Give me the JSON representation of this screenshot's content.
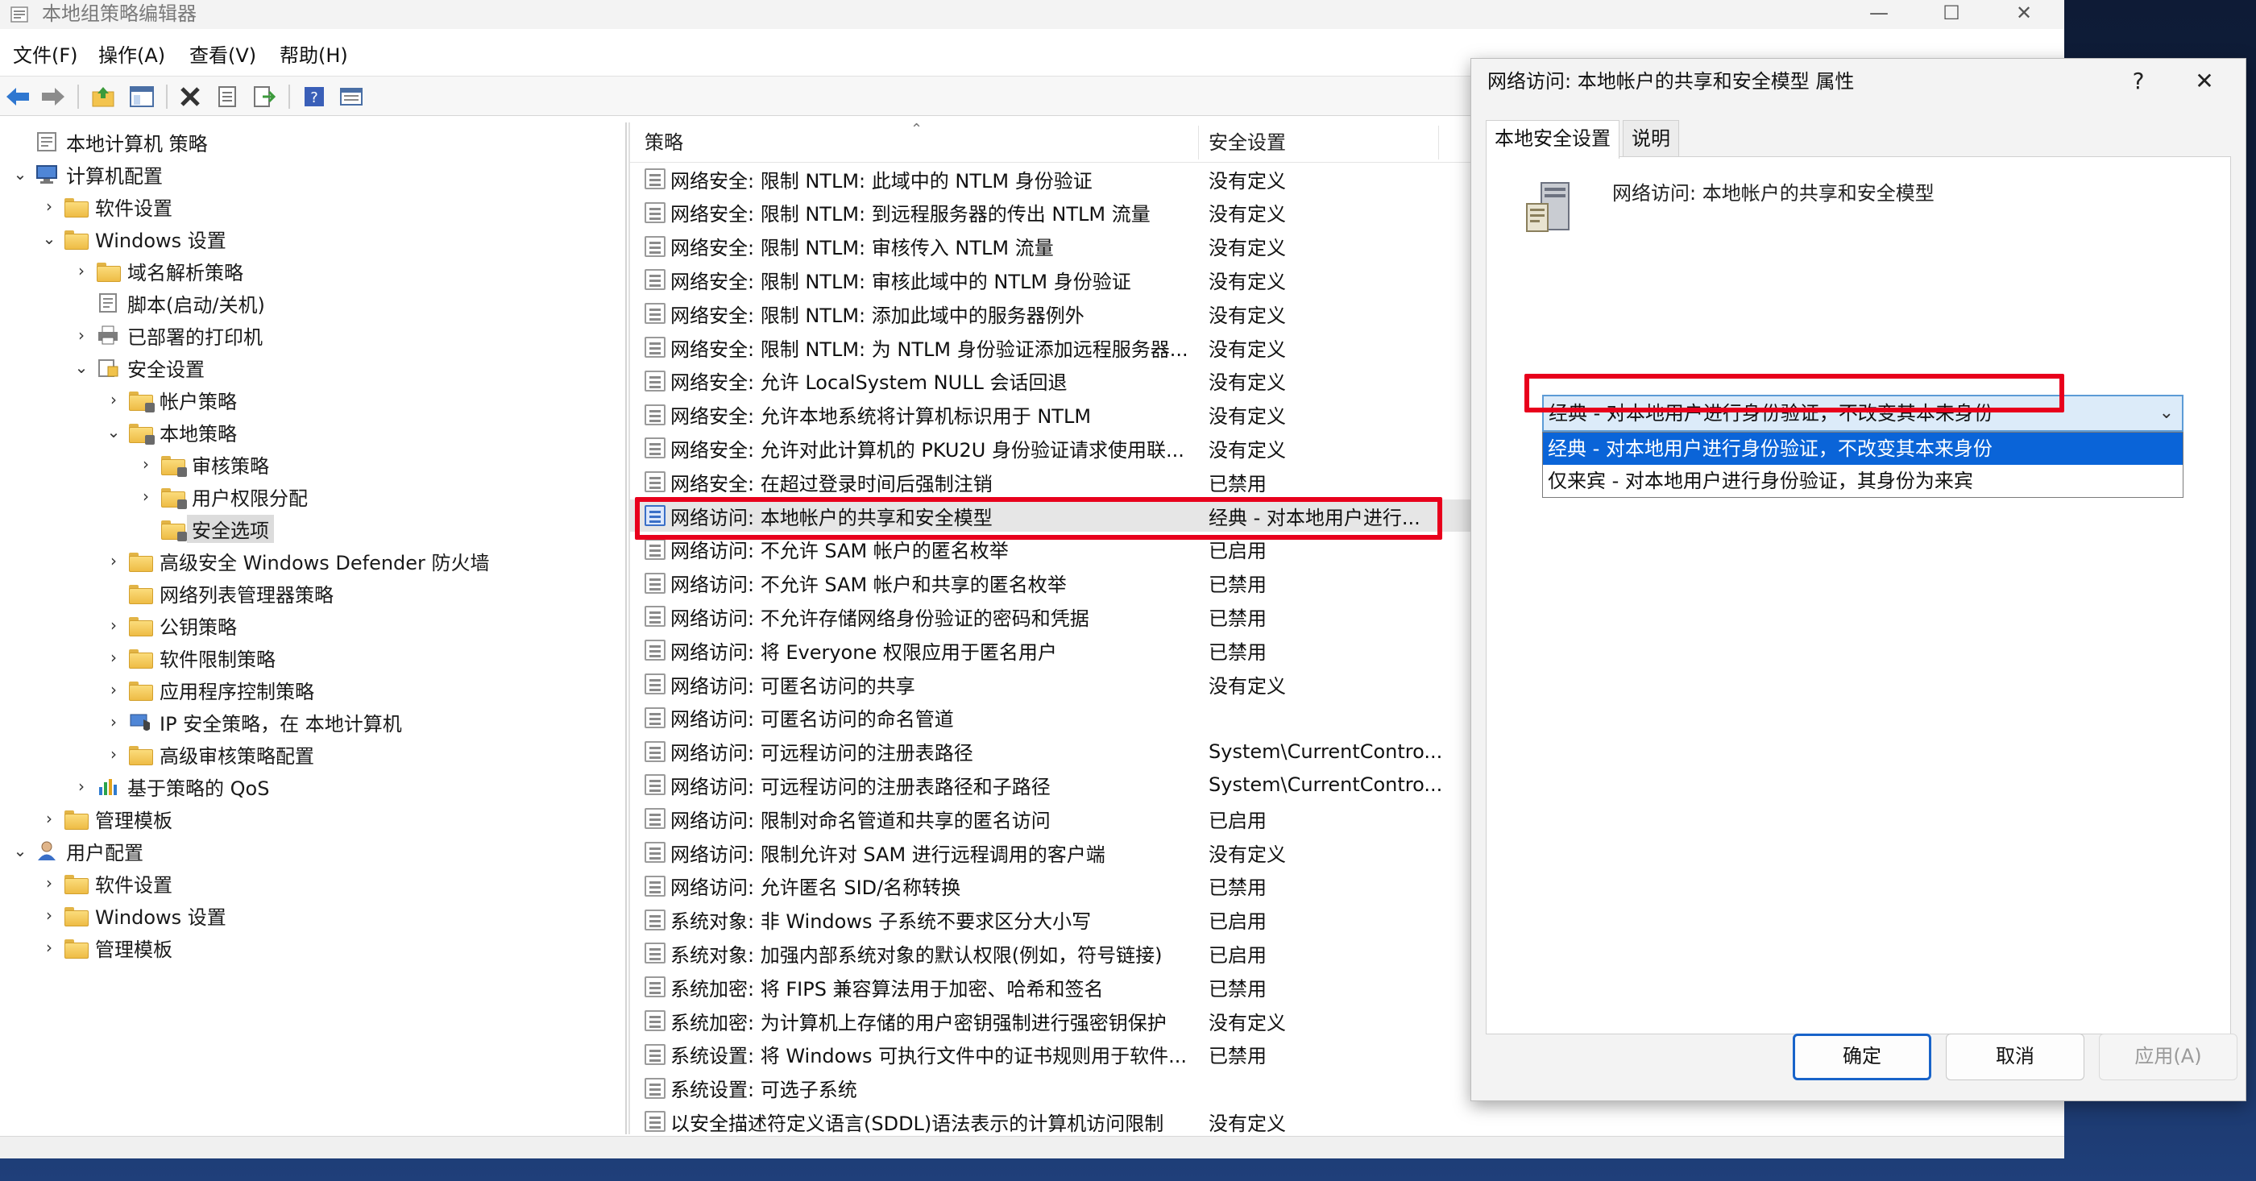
{
  "window": {
    "title": "本地组策略编辑器",
    "controls": {
      "minimize": "—",
      "maximize": "☐",
      "close": "✕"
    }
  },
  "menu": [
    "文件(F)",
    "操作(A)",
    "查看(V)",
    "帮助(H)"
  ],
  "toolbar": {
    "buttons": [
      "back-icon",
      "forward-icon",
      "up-folder-icon",
      "show-hide-tree-icon",
      "delete-icon",
      "properties-icon",
      "export-icon",
      "help-icon",
      "view-icon"
    ]
  },
  "tree": {
    "items": [
      {
        "label": "本地计算机 策略",
        "level": 0,
        "expander": "none",
        "icon": "computer-policy-icon"
      },
      {
        "label": "计算机配置",
        "level": 0,
        "expander": "expanded",
        "icon": "computer-icon"
      },
      {
        "label": "软件设置",
        "level": 1,
        "expander": "collapsed",
        "icon": "folder-icon"
      },
      {
        "label": "Windows 设置",
        "level": 1,
        "expander": "expanded",
        "icon": "folder-icon"
      },
      {
        "label": "域名解析策略",
        "level": 2,
        "expander": "collapsed",
        "icon": "folder-icon"
      },
      {
        "label": "脚本(启动/关机)",
        "level": 2,
        "expander": "none",
        "icon": "script-icon"
      },
      {
        "label": "已部署的打印机",
        "level": 2,
        "expander": "collapsed",
        "icon": "printer-icon"
      },
      {
        "label": "安全设置",
        "level": 2,
        "expander": "expanded",
        "icon": "security-settings-icon"
      },
      {
        "label": "帐户策略",
        "level": 3,
        "expander": "collapsed",
        "icon": "locked-folder-icon"
      },
      {
        "label": "本地策略",
        "level": 3,
        "expander": "expanded",
        "icon": "locked-folder-icon"
      },
      {
        "label": "审核策略",
        "level": 4,
        "expander": "collapsed",
        "icon": "locked-folder-icon"
      },
      {
        "label": "用户权限分配",
        "level": 4,
        "expander": "collapsed",
        "icon": "locked-folder-icon"
      },
      {
        "label": "安全选项",
        "level": 4,
        "expander": "none",
        "icon": "locked-folder-icon",
        "selected": true
      },
      {
        "label": "高级安全 Windows Defender 防火墙",
        "level": 3,
        "expander": "collapsed",
        "icon": "folder-icon"
      },
      {
        "label": "网络列表管理器策略",
        "level": 3,
        "expander": "none",
        "icon": "folder-icon"
      },
      {
        "label": "公钥策略",
        "level": 3,
        "expander": "collapsed",
        "icon": "folder-icon"
      },
      {
        "label": "软件限制策略",
        "level": 3,
        "expander": "collapsed",
        "icon": "folder-icon"
      },
      {
        "label": "应用程序控制策略",
        "level": 3,
        "expander": "collapsed",
        "icon": "folder-icon"
      },
      {
        "label": "IP 安全策略，在 本地计算机",
        "level": 3,
        "expander": "collapsed",
        "icon": "ip-security-icon"
      },
      {
        "label": "高级审核策略配置",
        "level": 3,
        "expander": "collapsed",
        "icon": "folder-icon"
      },
      {
        "label": "基于策略的 QoS",
        "level": 2,
        "expander": "collapsed",
        "icon": "qos-chart-icon"
      },
      {
        "label": "管理模板",
        "level": 1,
        "expander": "collapsed",
        "icon": "folder-icon"
      },
      {
        "label": "用户配置",
        "level": 0,
        "expander": "expanded",
        "icon": "user-icon"
      },
      {
        "label": "软件设置",
        "level": 1,
        "expander": "collapsed",
        "icon": "folder-icon"
      },
      {
        "label": "Windows 设置",
        "level": 1,
        "expander": "collapsed",
        "icon": "folder-icon"
      },
      {
        "label": "管理模板",
        "level": 1,
        "expander": "collapsed",
        "icon": "folder-icon"
      }
    ]
  },
  "list": {
    "columns": {
      "policy": "策略",
      "setting": "安全设置"
    },
    "rows": [
      {
        "name": "网络安全: 限制 NTLM: 此域中的 NTLM 身份验证",
        "value": "没有定义"
      },
      {
        "name": "网络安全: 限制 NTLM: 到远程服务器的传出 NTLM 流量",
        "value": "没有定义"
      },
      {
        "name": "网络安全: 限制 NTLM: 审核传入 NTLM 流量",
        "value": "没有定义"
      },
      {
        "name": "网络安全: 限制 NTLM: 审核此域中的 NTLM 身份验证",
        "value": "没有定义"
      },
      {
        "name": "网络安全: 限制 NTLM: 添加此域中的服务器例外",
        "value": "没有定义"
      },
      {
        "name": "网络安全: 限制 NTLM: 为 NTLM 身份验证添加远程服务器...",
        "value": "没有定义"
      },
      {
        "name": "网络安全: 允许 LocalSystem NULL 会话回退",
        "value": "没有定义"
      },
      {
        "name": "网络安全: 允许本地系统将计算机标识用于 NTLM",
        "value": "没有定义"
      },
      {
        "name": "网络安全: 允许对此计算机的 PKU2U 身份验证请求使用联...",
        "value": "没有定义"
      },
      {
        "name": "网络安全: 在超过登录时间后强制注销",
        "value": "已禁用"
      },
      {
        "name": "网络访问: 本地帐户的共享和安全模型",
        "value": "经典 - 对本地用户进行...",
        "selected": true
      },
      {
        "name": "网络访问: 不允许 SAM 帐户的匿名枚举",
        "value": "已启用"
      },
      {
        "name": "网络访问: 不允许 SAM 帐户和共享的匿名枚举",
        "value": "已禁用"
      },
      {
        "name": "网络访问: 不允许存储网络身份验证的密码和凭据",
        "value": "已禁用"
      },
      {
        "name": "网络访问: 将 Everyone 权限应用于匿名用户",
        "value": "已禁用"
      },
      {
        "name": "网络访问: 可匿名访问的共享",
        "value": "没有定义"
      },
      {
        "name": "网络访问: 可匿名访问的命名管道",
        "value": ""
      },
      {
        "name": "网络访问: 可远程访问的注册表路径",
        "value": "System\\CurrentContro..."
      },
      {
        "name": "网络访问: 可远程访问的注册表路径和子路径",
        "value": "System\\CurrentContro..."
      },
      {
        "name": "网络访问: 限制对命名管道和共享的匿名访问",
        "value": "已启用"
      },
      {
        "name": "网络访问: 限制允许对 SAM 进行远程调用的客户端",
        "value": "没有定义"
      },
      {
        "name": "网络访问: 允许匿名 SID/名称转换",
        "value": "已禁用"
      },
      {
        "name": "系统对象: 非 Windows 子系统不要求区分大小写",
        "value": "已启用"
      },
      {
        "name": "系统对象: 加强内部系统对象的默认权限(例如，符号链接)",
        "value": "已启用"
      },
      {
        "name": "系统加密: 将 FIPS 兼容算法用于加密、哈希和签名",
        "value": "已禁用"
      },
      {
        "name": "系统加密: 为计算机上存储的用户密钥强制进行强密钥保护",
        "value": "没有定义"
      },
      {
        "name": "系统设置: 将 Windows 可执行文件中的证书规则用于软件...",
        "value": "已禁用"
      },
      {
        "name": "系统设置: 可选子系统",
        "value": ""
      },
      {
        "name": "以安全描述符定义语言(SDDL)语法表示的计算机访问限制",
        "value": "没有定义"
      }
    ]
  },
  "dialog": {
    "title": "网络访问: 本地帐户的共享和安全模型 属性",
    "help": "?",
    "close": "✕",
    "tabs": [
      "本地安全设置",
      "说明"
    ],
    "policy_name": "网络访问: 本地帐户的共享和安全模型",
    "select_value": "经典 - 对本地用户进行身份验证，不改变其本来身份",
    "options": [
      "经典 - 对本地用户进行身份验证，不改变其本来身份",
      "仅来宾 - 对本地用户进行身份验证，其身份为来宾"
    ],
    "buttons": {
      "ok": "确定",
      "cancel": "取消",
      "apply": "应用(A)"
    }
  },
  "colors": {
    "highlight_box": "#e8001c",
    "accent": "#0a64d8"
  }
}
